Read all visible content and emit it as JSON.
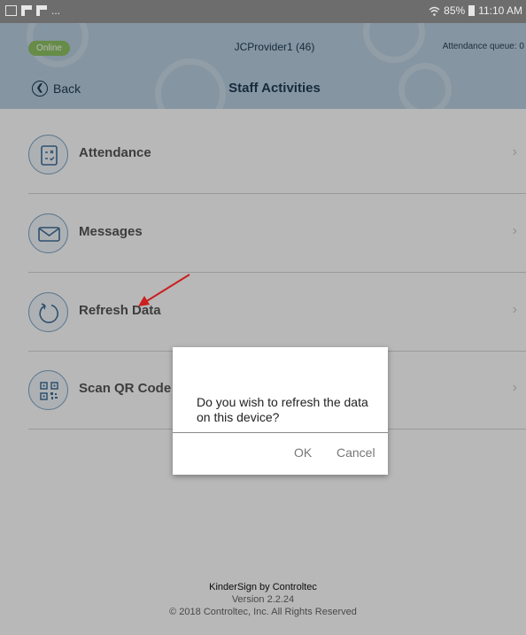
{
  "status_bar": {
    "overflow": "...",
    "battery": "85%",
    "time": "11:10 AM"
  },
  "header": {
    "status_badge": "Online",
    "provider": "JCProvider1 (46)",
    "queue": "Attendance queue: 0",
    "back_label": "Back",
    "title": "Staff Activities"
  },
  "menu": {
    "items": [
      {
        "label": "Attendance",
        "icon": "attendance-icon"
      },
      {
        "label": "Messages",
        "icon": "envelope-icon"
      },
      {
        "label": "Refresh Data",
        "icon": "refresh-icon"
      },
      {
        "label": "Scan QR Code",
        "icon": "qr-code-icon"
      }
    ]
  },
  "footer": {
    "app": "KinderSign by Controltec",
    "version": "Version 2.2.24",
    "copyright": "© 2018 Controltec, Inc. All Rights Reserved"
  },
  "dialog": {
    "message": "Do you wish to refresh the data on this device?",
    "ok_label": "OK",
    "cancel_label": "Cancel"
  },
  "colors": {
    "header_bg": "#b9cfe0",
    "online_badge": "#8ec265",
    "annotation_arrow": "#cc1f1f",
    "icon_ring": "#7fa7c8"
  }
}
